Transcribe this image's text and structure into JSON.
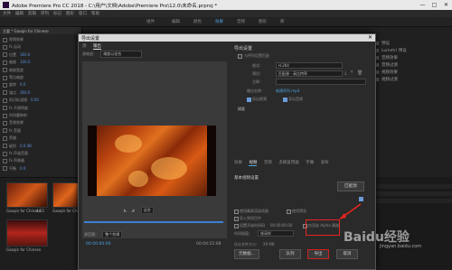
{
  "app": {
    "title": "Adobe Premiere Pro CC 2018 - C:\\用户\\文档\\Adobe\\Premiere Pro\\12.0\\未命名.prproj *",
    "window_controls": [
      "—",
      "□",
      "✕"
    ]
  },
  "menu": [
    "文件",
    "编辑",
    "剪辑",
    "序列",
    "标记",
    "图形",
    "窗口",
    "帮助"
  ],
  "workspace_tabs": [
    {
      "label": "组件",
      "active": false
    },
    {
      "label": "编辑",
      "active": false
    },
    {
      "label": "颜色",
      "active": false
    },
    {
      "label": "效果",
      "active": true
    },
    {
      "label": "音频",
      "active": false
    },
    {
      "label": "图形",
      "active": false
    },
    {
      "label": "库",
      "active": false
    }
  ],
  "left_panel": {
    "tab": "主要 * Gaoqin for Chinese",
    "rows": [
      {
        "label": "视频效果",
        "val": ""
      },
      {
        "label": "fx 运动",
        "val": ""
      },
      {
        "label": "位置",
        "val": "360.0"
      },
      {
        "label": "缩放",
        "val": "100.0"
      },
      {
        "label": "缩放宽度",
        "val": ""
      },
      {
        "label": "等比缩放",
        "val": ""
      },
      {
        "label": "旋转",
        "val": "0.0"
      },
      {
        "label": "锚点",
        "val": "360.0"
      },
      {
        "label": "防闪烁滤镜",
        "val": "0.00"
      },
      {
        "label": "fx 不透明度",
        "val": ""
      },
      {
        "label": "时间重映射",
        "val": ""
      },
      {
        "label": "音频效果",
        "val": ""
      },
      {
        "label": "fx 音量",
        "val": ""
      },
      {
        "label": "旁路",
        "val": ""
      },
      {
        "label": "级别",
        "val": "0.0 dB"
      },
      {
        "label": "fx 声道音量",
        "val": ""
      },
      {
        "label": "fx 声像器",
        "val": ""
      },
      {
        "label": "平衡",
        "val": "0.0"
      }
    ]
  },
  "bins": {
    "items": [
      {
        "label": "Gaoqin for Chinese",
        "duration": "4:22"
      },
      {
        "label": "Gaoqin for Chinese",
        "duration": "4:22"
      },
      {
        "label": "Gaoqin for Chinese",
        "duration": ""
      }
    ]
  },
  "right_panel": {
    "items": [
      "预设",
      "Lumetri 预设",
      "音频效果",
      "音频过渡",
      "视频效果",
      "视频过渡"
    ]
  },
  "dialog": {
    "title": "导出设置",
    "close": "✕",
    "source_tabs": [
      {
        "label": "源",
        "active": false
      },
      {
        "label": "输出",
        "active": true
      }
    ],
    "zoom_label": "源缩放：",
    "zoom_value": "缩放以适合",
    "timecode_in": "00:00:00:00",
    "timecode_out": "00:04:22:08",
    "source_range_label": "源范围：",
    "source_range_value": "整个剪辑",
    "fit_label": "适合",
    "settings": {
      "heading": "导出设置",
      "match_label": "与序列设置匹配",
      "format_label": "格式：",
      "format_value": "H.264",
      "preset_label": "预设：",
      "preset_value": "匹配源 - 高比特率",
      "comment_label": "注释：",
      "comment_value": "",
      "output_label": "输出名称：",
      "output_value": "新建序列.mp4",
      "export_video": "导出视频",
      "export_audio": "导出音频",
      "summary": "摘要",
      "tabs": [
        "效果",
        "视频",
        "音频",
        "多路复用器",
        "字幕",
        "发布"
      ],
      "basic_video_heading": "基本视频设置",
      "match_source_btn": "匹配源",
      "max_render": "使用最高渲染质量",
      "use_previews": "使用预览",
      "import_into_project": "导入到项目中",
      "set_start_tc": "设置开始时间码",
      "start_tc_value": "00:00:00:00",
      "render_alpha": "仅渲染 Alpha 通道",
      "time_interp_label": "时间插值：",
      "time_interp_value": "帧采样",
      "file_size_label": "估计文件大小：",
      "file_size_value": "29 MB",
      "buttons": {
        "metadata": "元数据...",
        "queue": "队列",
        "export": "导出",
        "cancel": "取消"
      }
    }
  },
  "watermark": {
    "main": "Baidu经验",
    "sub": "jingyan.baidu.com"
  },
  "colors": {
    "accent": "#4aa3df",
    "highlight": "#e3261d"
  }
}
